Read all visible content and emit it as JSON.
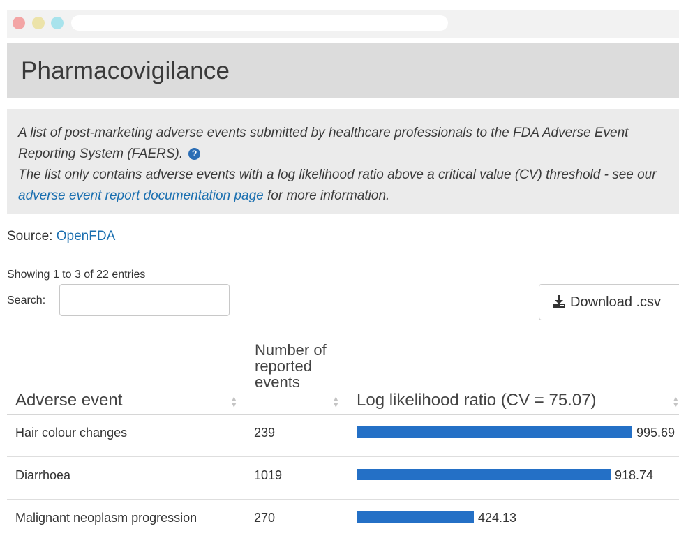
{
  "header": {
    "title": "Pharmacovigilance"
  },
  "description": {
    "line1": "A list of post-marketing adverse events submitted by healthcare professionals to the FDA Adverse Event Reporting System (FAERS).",
    "help_icon": "question-circle-icon",
    "line2_pre": "The list only contains adverse events with a log likelihood ratio above a critical value (CV) threshold - see our ",
    "link_text": "adverse event report documentation page",
    "line2_post": " for more information."
  },
  "source": {
    "label": "Source: ",
    "link_text": "OpenFDA"
  },
  "table_controls": {
    "info": "Showing 1 to 3 of 22 entries",
    "search_label": "Search:",
    "search_value": "",
    "download_label": "Download .csv",
    "download_icon": "download-icon"
  },
  "table": {
    "columns": {
      "event": "Adverse event",
      "count": "Number of reported events",
      "llr": "Log likelihood ratio (CV = 75.07)"
    },
    "sort_icon": "sort-icon",
    "llr_max": 995.69,
    "bar_color": "#2470c6",
    "rows": [
      {
        "event": "Hair colour changes",
        "count": "239",
        "llr": 995.69,
        "llr_label": "995.69"
      },
      {
        "event": "Diarrhoea",
        "count": "1019",
        "llr": 918.74,
        "llr_label": "918.74"
      },
      {
        "event": "Malignant neoplasm progression",
        "count": "270",
        "llr": 424.13,
        "llr_label": "424.13"
      }
    ]
  }
}
